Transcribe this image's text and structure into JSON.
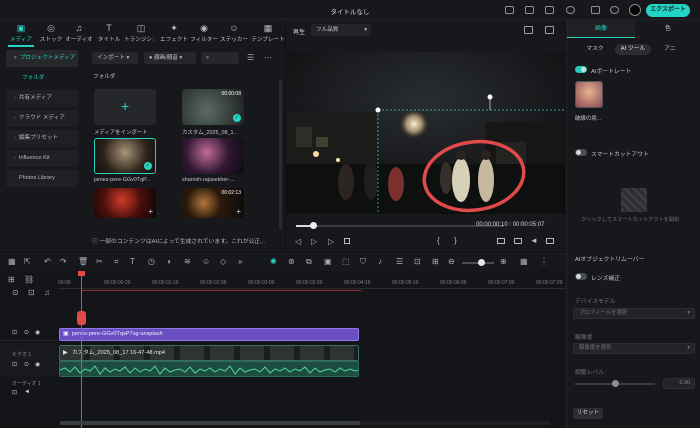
{
  "window": {
    "title": "タイトルなし",
    "export_label": "エクスポート"
  },
  "toolbar_tabs": [
    {
      "label": "メディア",
      "icon": "media-icon"
    },
    {
      "label": "ストック",
      "icon": "stock-icon"
    },
    {
      "label": "オーディオ",
      "icon": "audio-icon"
    },
    {
      "label": "タイトル",
      "icon": "title-icon"
    },
    {
      "label": "トランジション",
      "icon": "transition-icon"
    },
    {
      "label": "エフェクト",
      "icon": "effect-icon"
    },
    {
      "label": "フィルター",
      "icon": "filter-icon"
    },
    {
      "label": "ステッカー",
      "icon": "sticker-icon"
    },
    {
      "label": "テンプレート",
      "icon": "template-icon"
    }
  ],
  "sidebar": {
    "items": [
      {
        "label": "プロジェクトメディア"
      },
      {
        "label": "フォルダ"
      },
      {
        "label": "共有メディア"
      },
      {
        "label": "クラウド メディア"
      },
      {
        "label": "編集プリセット"
      },
      {
        "label": "Influence Kit"
      },
      {
        "label": "Photos Library"
      }
    ]
  },
  "media": {
    "import_dropdown": "インポート",
    "sort_dropdown": "顔画/顔音",
    "folder_label": "フォルダ",
    "import_tile_label": "メディアをインポート",
    "items": [
      {
        "name": "カスタム_2025_08_1...",
        "duration": "00:00:08"
      },
      {
        "name": "james-pere-GGv0TqP...",
        "duration": ""
      },
      {
        "name": "sharosh-rajasekher-...",
        "duration": ""
      },
      {
        "name": "",
        "duration": ""
      },
      {
        "name": "",
        "duration": "00:02:13"
      }
    ],
    "ai_notice": "一部のコンテンツはAIによって生成されています。これが公正..."
  },
  "preview": {
    "play_label": "再生",
    "quality": "フル品質",
    "current_time": "00:00:00:10",
    "total_time": "00:00:05:07",
    "progress": 0.08
  },
  "right_panel": {
    "tabs": [
      "画像",
      "色"
    ],
    "subtabs": [
      "マスク",
      "AI ツール",
      "アニ"
    ],
    "ai_portrait_label": "AIポートレート",
    "portrait_caption": "破線の境...",
    "smart_cutout_label": "スマートカットアウト",
    "smart_cutout_hint": "クリックしてスマートカットアウトを開始",
    "object_remover_label": "AIオブジェクトリムーバー",
    "lens_correction_label": "レンズ補正",
    "device_model_label": "デバイスモデル",
    "device_model_value": "プロフィールを選択",
    "resolution_label": "解像度",
    "resolution_value": "解像度を選択",
    "adjust_level_label": "調整レベル",
    "adjust_level_value": "0.00",
    "adjust_level": 0.5,
    "reset_label": "リセット"
  },
  "timeline": {
    "ruler": [
      "00:00",
      "00:00:00:20",
      "00:00:01:10",
      "00:00:02:05",
      "00:00:03:00",
      "00:00:03:20",
      "00:00:04:15",
      "00:00:05:10",
      "00:00:06:05",
      "00:00:07:00",
      "00:00:07:20"
    ],
    "tracks": [
      {
        "label": ""
      },
      {
        "label": "ビデオ 1"
      },
      {
        "label": "オーディオ 1"
      }
    ],
    "image_clip": "james-pere-GGv0TqsP7xg-unsplash",
    "video_clip": "カスタム_2025_08_17 16-47-48.mp4",
    "zoom": 0.6
  },
  "colors": {
    "accent": "#29d3c2",
    "image_clip": "#6a4fc3",
    "playhead": "#e24a4a"
  }
}
